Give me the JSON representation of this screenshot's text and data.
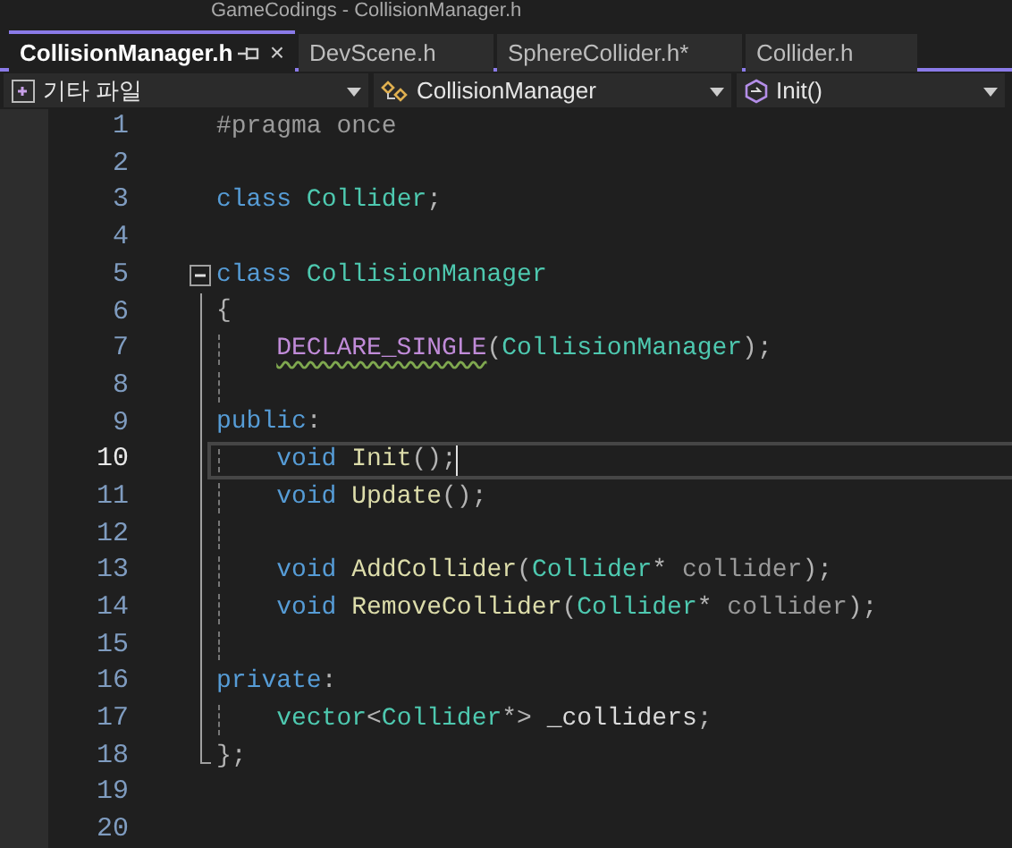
{
  "window": {
    "title": "GameCodings - CollisionManager.h"
  },
  "tabs": [
    {
      "label": "CollisionManager.h",
      "selected": true,
      "close": "×"
    },
    {
      "label": "DevScene.h",
      "selected": false
    },
    {
      "label": "SphereCollider.h*",
      "selected": false
    },
    {
      "label": "Collider.h",
      "selected": false
    }
  ],
  "navbar": [
    {
      "kind": "project",
      "label": "기타 파일"
    },
    {
      "kind": "class",
      "label": "CollisionManager"
    },
    {
      "kind": "method",
      "label": "Init()"
    }
  ],
  "lines": [
    {
      "number": "1",
      "kind": "outside",
      "indented": false,
      "guide": false,
      "current": false,
      "tokens": [
        {
          "text": "#pragma once",
          "kind": "preproc"
        }
      ]
    },
    {
      "number": "2",
      "kind": "outside",
      "guide": false,
      "current": false
    },
    {
      "number": "3",
      "kind": "outside",
      "indented": false,
      "guide": false,
      "current": false,
      "tokens": [
        {
          "text": "class ",
          "kind": "keyword"
        },
        {
          "text": "Collider",
          "kind": "type"
        },
        {
          "text": ";",
          "kind": "punct"
        }
      ]
    },
    {
      "number": "4",
      "kind": "outside",
      "guide": false,
      "current": false
    },
    {
      "number": "5",
      "kind": "header",
      "expanded": true,
      "indented": false,
      "guide": false,
      "current": false,
      "tokens": [
        {
          "text": "class ",
          "kind": "keyword"
        },
        {
          "text": "CollisionManager",
          "kind": "type"
        }
      ]
    },
    {
      "number": "6",
      "kind": "member",
      "indented": false,
      "guide": false,
      "current": false,
      "tokens": [
        {
          "text": "{",
          "kind": "punct"
        }
      ]
    },
    {
      "number": "7",
      "kind": "member",
      "indented": true,
      "guide": true,
      "current": false,
      "tokens": [
        {
          "text": "DECLARE_SINGLE",
          "kind": "macro",
          "squiggle": true
        },
        {
          "text": "(",
          "kind": "punct"
        },
        {
          "text": "CollisionManager",
          "kind": "type"
        },
        {
          "text": ");",
          "kind": "punct"
        }
      ]
    },
    {
      "number": "8",
      "kind": "member",
      "guide": true,
      "current": false
    },
    {
      "number": "9",
      "kind": "member",
      "indented": false,
      "guide": false,
      "current": false,
      "tokens": [
        {
          "text": "public",
          "kind": "keyword"
        },
        {
          "text": ":",
          "kind": "punct"
        }
      ]
    },
    {
      "number": "10",
      "kind": "member",
      "indented": true,
      "guide": true,
      "current": true,
      "tokens": [
        {
          "text": "void ",
          "kind": "keyword"
        },
        {
          "text": "Init",
          "kind": "function"
        },
        {
          "text": "();",
          "kind": "punct"
        }
      ]
    },
    {
      "number": "11",
      "kind": "member",
      "indented": true,
      "guide": true,
      "current": false,
      "tokens": [
        {
          "text": "void ",
          "kind": "keyword"
        },
        {
          "text": "Update",
          "kind": "function"
        },
        {
          "text": "();",
          "kind": "punct"
        }
      ]
    },
    {
      "number": "12",
      "kind": "member",
      "guide": true,
      "current": false
    },
    {
      "number": "13",
      "kind": "member",
      "indented": true,
      "guide": true,
      "current": false,
      "tokens": [
        {
          "text": "void ",
          "kind": "keyword"
        },
        {
          "text": "AddCollider",
          "kind": "function"
        },
        {
          "text": "(",
          "kind": "punct"
        },
        {
          "text": "Collider",
          "kind": "type"
        },
        {
          "text": "* ",
          "kind": "punct"
        },
        {
          "text": "collider",
          "kind": "param"
        },
        {
          "text": ");",
          "kind": "punct"
        }
      ]
    },
    {
      "number": "14",
      "kind": "member",
      "indented": true,
      "guide": true,
      "current": false,
      "tokens": [
        {
          "text": "void ",
          "kind": "keyword"
        },
        {
          "text": "RemoveCollider",
          "kind": "function"
        },
        {
          "text": "(",
          "kind": "punct"
        },
        {
          "text": "Collider",
          "kind": "type"
        },
        {
          "text": "* ",
          "kind": "punct"
        },
        {
          "text": "collider",
          "kind": "param"
        },
        {
          "text": ");",
          "kind": "punct"
        }
      ]
    },
    {
      "number": "15",
      "kind": "member",
      "guide": true,
      "current": false
    },
    {
      "number": "16",
      "kind": "member",
      "indented": false,
      "guide": false,
      "current": false,
      "tokens": [
        {
          "text": "private",
          "kind": "keyword"
        },
        {
          "text": ":",
          "kind": "punct"
        }
      ]
    },
    {
      "number": "17",
      "kind": "member",
      "indented": true,
      "guide": true,
      "current": false,
      "tokens": [
        {
          "text": "vector",
          "kind": "type"
        },
        {
          "text": "<",
          "kind": "punct"
        },
        {
          "text": "Collider",
          "kind": "type"
        },
        {
          "text": "*> ",
          "kind": "punct"
        },
        {
          "text": "_colliders",
          "kind": "field"
        },
        {
          "text": ";",
          "kind": "punct"
        }
      ]
    },
    {
      "number": "18",
      "kind": "closer",
      "indented": false,
      "guide": false,
      "current": false,
      "tokens": [
        {
          "text": "};",
          "kind": "punct"
        }
      ]
    },
    {
      "number": "19",
      "kind": "outside",
      "guide": false,
      "current": false
    },
    {
      "number": "20",
      "kind": "outside",
      "guide": false,
      "current": false
    }
  ]
}
